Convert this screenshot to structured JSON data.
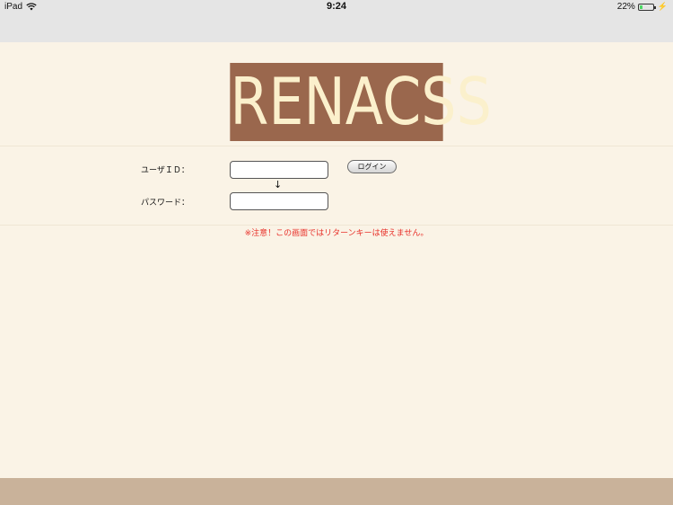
{
  "status_bar": {
    "device": "iPad",
    "wifi_icon": "wifi-icon",
    "time": "9:24",
    "battery_percent": "22%",
    "battery_level": 0.22,
    "battery_icon": "battery-icon",
    "charging_icon": "bolt-icon"
  },
  "logo": {
    "text": "RENACSS",
    "background": "#9a674d",
    "color": "#fbf0cc"
  },
  "login_form": {
    "user_id_label": "ユーザＩＤ：",
    "user_id_value": "",
    "arrow": "↓",
    "password_label": "パスワード：",
    "password_value": "",
    "login_button_label": "ログイン"
  },
  "warning": {
    "text": "※注意！この画面ではリターンキーは使えません。",
    "color": "#e8312a"
  },
  "colors": {
    "page_background": "#faf3e6",
    "footer_background": "#c9b29a",
    "status_bar_background": "#e5e5e5"
  }
}
